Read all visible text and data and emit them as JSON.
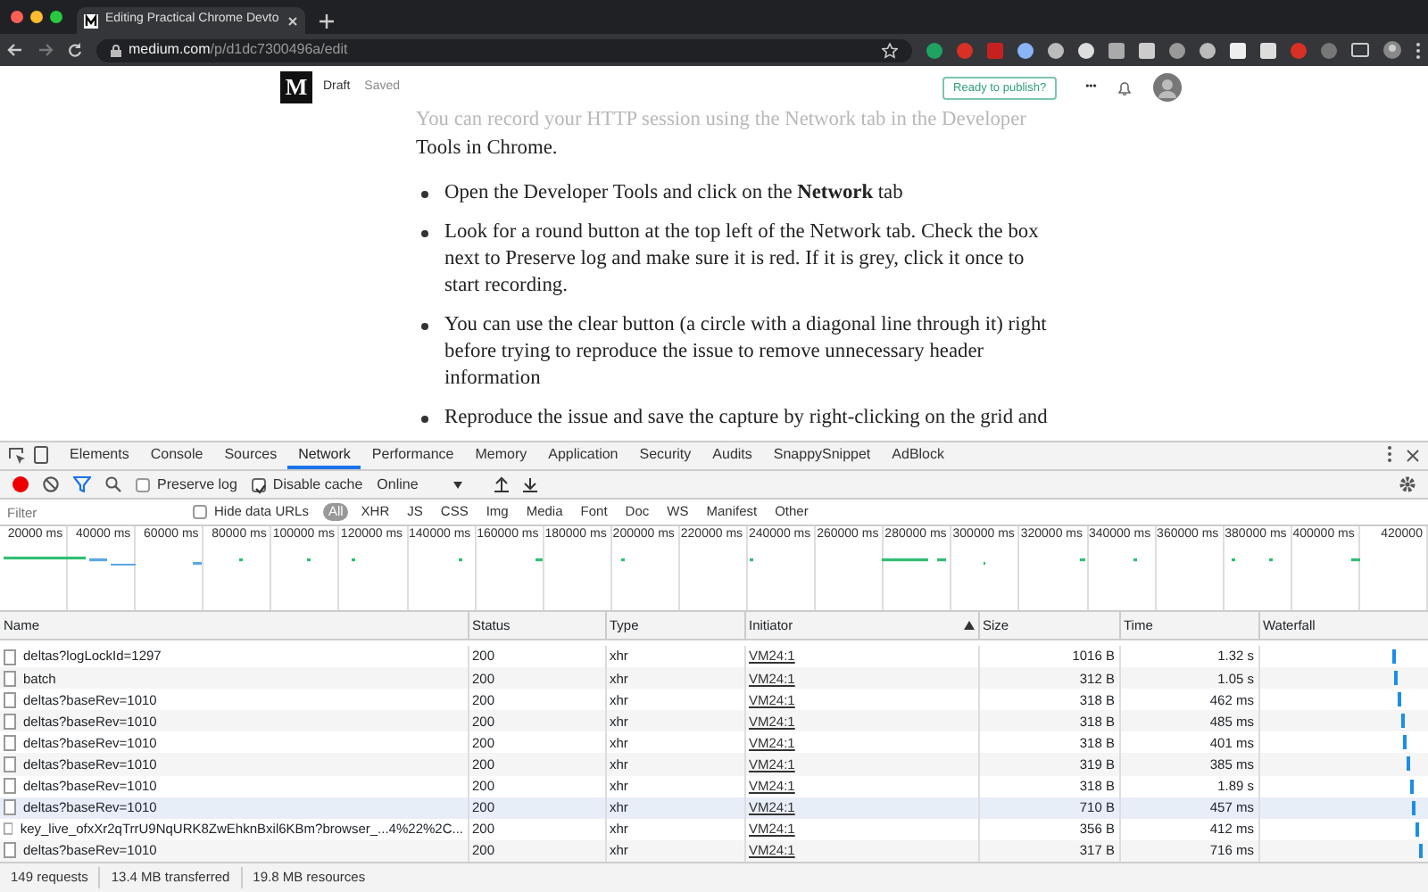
{
  "browser": {
    "tab_title": "Editing Practical Chrome Devto",
    "url_host": "medium.com",
    "url_path": "/p/d1dc7300496a/edit"
  },
  "editor": {
    "logo": "M",
    "status": "Draft",
    "saved": "Saved",
    "publish_button": "Ready to publish?",
    "more": "•••",
    "faded_line": "You can record your HTTP session using the Network tab in the Developer",
    "line": "Tools in Chrome.",
    "bullets": [
      "Open the Developer Tools and click on the **Network** tab",
      "Look for a round button at the top left of the Network tab. Check the box next to Preserve log and make sure it is red. If it is grey, click it once to start recording.",
      "You can use the clear button (a circle with a diagonal line through it) right before trying to reproduce the issue to remove unnecessary header information",
      "Reproduce the issue and save the capture by right-clicking on the grid and"
    ]
  },
  "devtools": {
    "tabs": [
      {
        "label": "Elements",
        "selected": false
      },
      {
        "label": "Console",
        "selected": false
      },
      {
        "label": "Sources",
        "selected": false
      },
      {
        "label": "Network",
        "selected": true
      },
      {
        "label": "Performance",
        "selected": false
      },
      {
        "label": "Memory",
        "selected": false
      },
      {
        "label": "Application",
        "selected": false
      },
      {
        "label": "Security",
        "selected": false
      },
      {
        "label": "Audits",
        "selected": false
      },
      {
        "label": "SnappySnippet",
        "selected": false
      },
      {
        "label": "AdBlock",
        "selected": false
      }
    ],
    "toolbar": {
      "recording": true,
      "preserve_log": {
        "label": "Preserve log",
        "checked": false
      },
      "disable_cache": {
        "label": "Disable cache",
        "checked": true
      },
      "throttling": "Online"
    },
    "filter": {
      "placeholder": "Filter",
      "hide_data_urls": {
        "label": "Hide data URLs",
        "checked": false
      },
      "types": [
        {
          "label": "All",
          "selected": true
        },
        {
          "label": "XHR",
          "selected": false
        },
        {
          "label": "JS",
          "selected": false
        },
        {
          "label": "CSS",
          "selected": false
        },
        {
          "label": "Img",
          "selected": false
        },
        {
          "label": "Media",
          "selected": false
        },
        {
          "label": "Font",
          "selected": false
        },
        {
          "label": "Doc",
          "selected": false
        },
        {
          "label": "WS",
          "selected": false
        },
        {
          "label": "Manifest",
          "selected": false
        },
        {
          "label": "Other",
          "selected": false
        }
      ]
    },
    "overview_ticks": [
      "20000 ms",
      "40000 ms",
      "60000 ms",
      "80000 ms",
      "100000 ms",
      "120000 ms",
      "140000 ms",
      "160000 ms",
      "180000 ms",
      "200000 ms",
      "220000 ms",
      "240000 ms",
      "260000 ms",
      "280000 ms",
      "300000 ms",
      "320000 ms",
      "340000 ms",
      "360000 ms",
      "380000 ms",
      "400000 ms",
      "420000"
    ],
    "table": {
      "columns": [
        {
          "label": "Name",
          "sorted": false
        },
        {
          "label": "Status",
          "sorted": false
        },
        {
          "label": "Type",
          "sorted": false
        },
        {
          "label": "Initiator",
          "sorted": true
        },
        {
          "label": "Size",
          "sorted": false
        },
        {
          "label": "Time",
          "sorted": false
        },
        {
          "label": "Waterfall",
          "sorted": false
        }
      ],
      "rows": [
        {
          "name": "deltas?logLockId=1297",
          "status": "200",
          "type": "xhr",
          "initiator": "VM24:1",
          "size": "1016 B",
          "time": "1.32 s",
          "selected": false
        },
        {
          "name": "batch",
          "status": "200",
          "type": "xhr",
          "initiator": "VM24:1",
          "size": "312 B",
          "time": "1.05 s",
          "selected": false
        },
        {
          "name": "deltas?baseRev=1010",
          "status": "200",
          "type": "xhr",
          "initiator": "VM24:1",
          "size": "318 B",
          "time": "462 ms",
          "selected": false
        },
        {
          "name": "deltas?baseRev=1010",
          "status": "200",
          "type": "xhr",
          "initiator": "VM24:1",
          "size": "318 B",
          "time": "485 ms",
          "selected": false
        },
        {
          "name": "deltas?baseRev=1010",
          "status": "200",
          "type": "xhr",
          "initiator": "VM24:1",
          "size": "318 B",
          "time": "401 ms",
          "selected": false
        },
        {
          "name": "deltas?baseRev=1010",
          "status": "200",
          "type": "xhr",
          "initiator": "VM24:1",
          "size": "319 B",
          "time": "385 ms",
          "selected": false
        },
        {
          "name": "deltas?baseRev=1010",
          "status": "200",
          "type": "xhr",
          "initiator": "VM24:1",
          "size": "318 B",
          "time": "1.89 s",
          "selected": false
        },
        {
          "name": "deltas?baseRev=1010",
          "status": "200",
          "type": "xhr",
          "initiator": "VM24:1",
          "size": "710 B",
          "time": "457 ms",
          "selected": true
        },
        {
          "name": "key_live_ofxXr2qTrrU9NqURK8ZwEhknBxil6KBm?browser_...4%22%2C...",
          "status": "200",
          "type": "xhr",
          "initiator": "VM24:1",
          "size": "356 B",
          "time": "412 ms",
          "selected": false
        },
        {
          "name": "deltas?baseRev=1010",
          "status": "200",
          "type": "xhr",
          "initiator": "VM24:1",
          "size": "317 B",
          "time": "716 ms",
          "selected": false
        }
      ]
    },
    "status_bar": [
      "149 requests",
      "13.4 MB transferred",
      "19.8 MB resources"
    ]
  }
}
